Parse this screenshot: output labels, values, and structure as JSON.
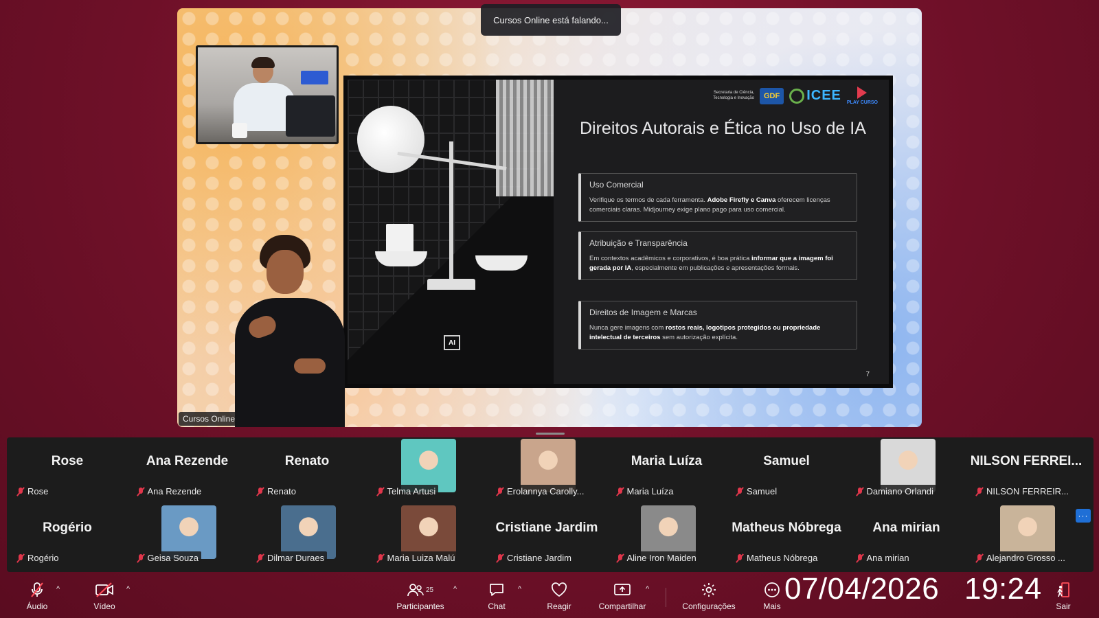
{
  "toast": {
    "speaking": "Cursos Online está falando..."
  },
  "stage": {
    "label": "Cursos Online"
  },
  "slide": {
    "title": "Direitos Autorais e Ética no Uso de IA",
    "logos": {
      "secretaria": "Secretaria de Ciência, Tecnologia e Inovação",
      "gdf": "GDF",
      "icee": "ICEE",
      "play": "PLAY CURSO"
    },
    "ai_chip": "AI",
    "cards": [
      {
        "heading": "Uso Comercial",
        "body_pre": "Verifique os termos de cada ferramenta. ",
        "body_bold": "Adobe Firefly e Canva",
        "body_post": " oferecem licenças comerciais claras. Midjourney exige plano pago para uso comercial."
      },
      {
        "heading": "Atribuição e Transparência",
        "body_pre": "Em contextos acadêmicos e corporativos, é boa prática ",
        "body_bold": "informar que a imagem foi gerada por IA",
        "body_post": ", especialmente em publicações e apresentações formais."
      },
      {
        "heading": "Direitos de Imagem e Marcas",
        "body_pre": "Nunca gere imagens com ",
        "body_bold": "rostos reais, logotipos protegidos ou propriedade intelectual de terceiros",
        "body_post": " sem autorização explícita."
      }
    ],
    "page_number": "7"
  },
  "gallery": {
    "row1": [
      {
        "big": "Rose",
        "tag": "Rose",
        "video": false
      },
      {
        "big": "Ana Rezende",
        "tag": "Ana Rezende",
        "video": false
      },
      {
        "big": "Renato",
        "tag": "Renato",
        "video": false
      },
      {
        "big": "",
        "tag": "Telma Artusi",
        "video": true,
        "color": "#5fc7c0"
      },
      {
        "big": "",
        "tag": "Erolannya Carolly...",
        "video": true,
        "color": "#c9a58c"
      },
      {
        "big": "Maria Luíza",
        "tag": "Maria Luíza",
        "video": false
      },
      {
        "big": "Samuel",
        "tag": "Samuel",
        "video": false
      },
      {
        "big": "",
        "tag": "Damiano Orlandi",
        "video": true,
        "color": "#d9d9d9"
      },
      {
        "big": "NILSON FERREI...",
        "tag": "NILSON FERREIR...",
        "video": false
      }
    ],
    "row2": [
      {
        "big": "Rogério",
        "tag": "Rogério",
        "video": false
      },
      {
        "big": "",
        "tag": "Geisa Souza",
        "video": true,
        "color": "#6a9ac4"
      },
      {
        "big": "",
        "tag": "Dilmar Duraes",
        "video": true,
        "color": "#4a6e8e"
      },
      {
        "big": "",
        "tag": "Maria Luiza Malú",
        "video": true,
        "color": "#7a4a3a"
      },
      {
        "big": "Cristiane Jardim",
        "tag": "Cristiane Jardim",
        "video": false
      },
      {
        "big": "",
        "tag": "Aline Iron Maiden",
        "video": true,
        "color": "#8a8a8a"
      },
      {
        "big": "Matheus Nóbrega",
        "tag": "Matheus Nóbrega",
        "video": false
      },
      {
        "big": "Ana mirian",
        "tag": "Ana mirian",
        "video": false
      },
      {
        "big": "",
        "tag": "Alejandro Grosso ...",
        "video": true,
        "color": "#c9b49a"
      }
    ],
    "more_label": "···"
  },
  "toolbar": {
    "audio": "Áudio",
    "video": "Vídeo",
    "participants": "Participantes",
    "participants_count": "25",
    "chat": "Chat",
    "react": "Reagir",
    "share": "Compartilhar",
    "settings": "Configurações",
    "more": "Mais",
    "leave": "Sair"
  },
  "overlay": {
    "date": "07/04/2026",
    "time": "19:24"
  },
  "colors": {
    "background": "#6e1028",
    "mute": "#e0364b",
    "accent": "#1f6fd6"
  }
}
